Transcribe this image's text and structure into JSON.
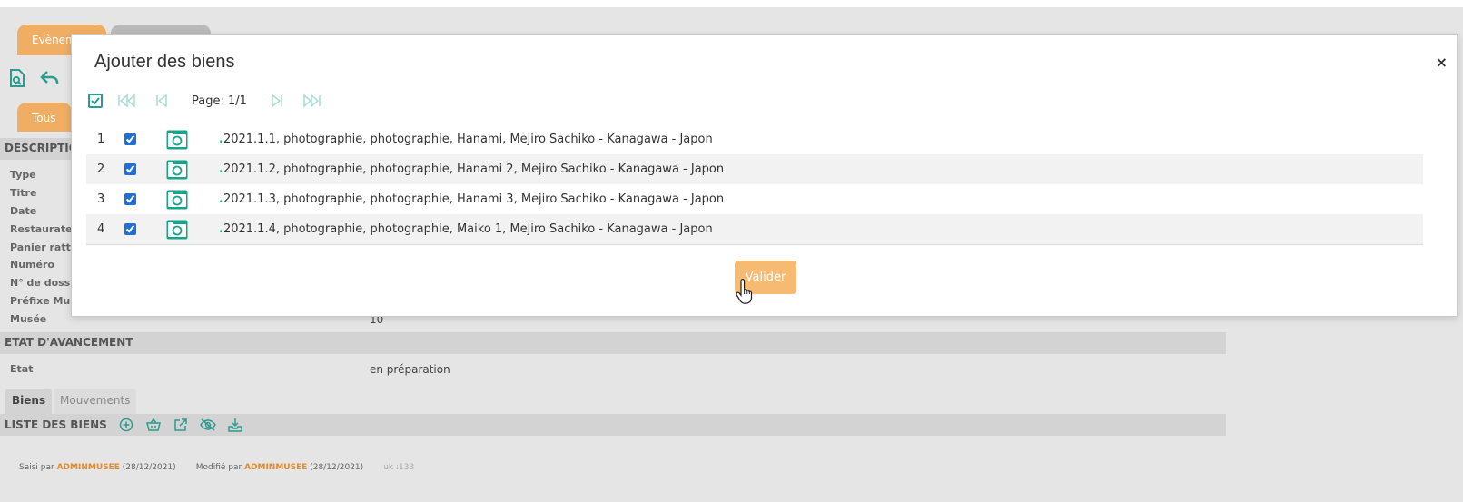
{
  "background": {
    "tabs": [
      "Evènem",
      ""
    ],
    "tab_tous": "Tous",
    "section_description": "DESCRIPTIO",
    "fields": [
      {
        "label": "Type",
        "value": ""
      },
      {
        "label": "Titre",
        "value": ""
      },
      {
        "label": "Date",
        "value": ""
      },
      {
        "label": "Restaurateur",
        "value": ""
      },
      {
        "label": "Panier rattac",
        "value": ""
      },
      {
        "label": "Numéro",
        "value": ""
      },
      {
        "label": "N° de dossie",
        "value": ""
      },
      {
        "label": "Préfixe Musé",
        "value": ""
      },
      {
        "label": "Musée",
        "value": "10"
      }
    ],
    "section_etat": "ETAT D'AVANCEMENT",
    "etat_label": "Etat",
    "etat_value": "en préparation",
    "subtabs": {
      "biens": "Biens",
      "mouvements": "Mouvements"
    },
    "liste_title": "LISTE DES BIENS",
    "liste_icons": [
      "add-circle-icon",
      "basket-icon",
      "external-link-icon",
      "eye-off-icon",
      "download-tray-icon"
    ],
    "footer": {
      "saisi_prefix": "Saisi par",
      "saisi_user": "ADMINMUSEE",
      "saisi_date": "(28/12/2021)",
      "modifie_prefix": "Modifié par",
      "modifie_user": "ADMINMUSEE",
      "modifie_date": "(28/12/2021)",
      "uk": "uk :133"
    }
  },
  "modal": {
    "title": "Ajouter des biens",
    "close": "×",
    "page_label": "Page: 1/1",
    "rows": [
      {
        "num": "1",
        "checked": true,
        "text": "2021.1.1, photographie, photographie, Hanami, Mejiro Sachiko - Kanagawa - Japon"
      },
      {
        "num": "2",
        "checked": true,
        "text": "2021.1.2, photographie, photographie, Hanami 2, Mejiro Sachiko - Kanagawa - Japon"
      },
      {
        "num": "3",
        "checked": true,
        "text": "2021.1.3, photographie, photographie, Hanami 3, Mejiro Sachiko - Kanagawa - Japon"
      },
      {
        "num": "4",
        "checked": true,
        "text": "2021.1.4, photographie, photographie, Maiko 1, Mejiro Sachiko - Kanagawa - Japon"
      }
    ],
    "submit_label": "Valider"
  },
  "colors": {
    "accent_teal": "#2a9d8f",
    "orange": "#f0ad64",
    "button_orange": "#f7ba73"
  }
}
